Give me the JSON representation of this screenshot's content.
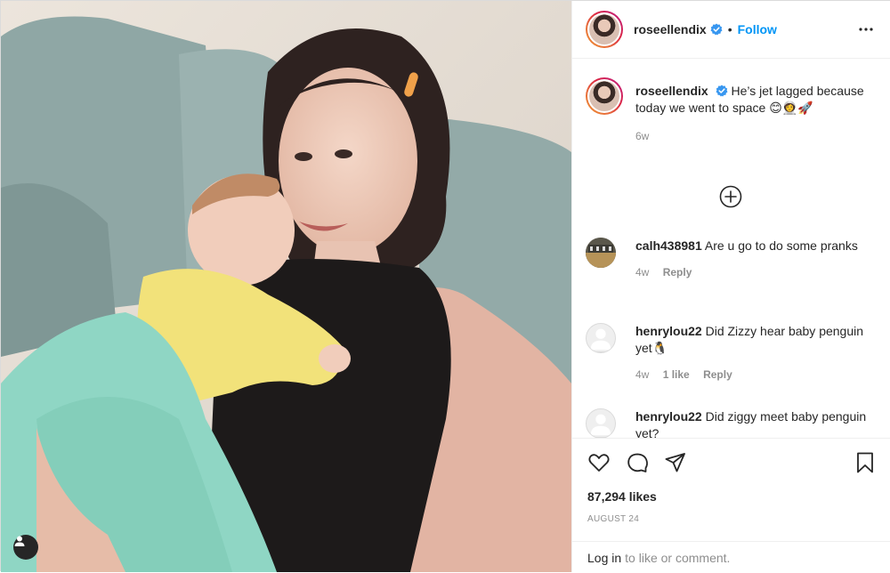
{
  "post": {
    "username": "roseellendix",
    "follow_label": "Follow",
    "dot": "•"
  },
  "caption": {
    "username": "roseellendix",
    "text": "He’s jet lagged because today we went to space 😊👩‍🚀🚀",
    "age": "6w"
  },
  "comments": [
    {
      "username": "calh438981",
      "text": "Are u go to do some pranks",
      "age": "4w",
      "likes": "",
      "reply_label": "Reply"
    },
    {
      "username": "henrylou22",
      "text": "Did Zizzy hear baby penguin yet🐧",
      "age": "4w",
      "likes": "1 like",
      "reply_label": "Reply"
    },
    {
      "username": "henrylou22",
      "text": "Did ziggy meet baby penguin yet?",
      "age": "",
      "likes": "",
      "reply_label": ""
    }
  ],
  "stats": {
    "likes": "87,294 likes",
    "date": "AUGUST 24"
  },
  "login_prompt": {
    "link": "Log in",
    "rest": "to like or comment."
  },
  "icons": {
    "verified": "verified-badge-icon",
    "more": "more-options-icon",
    "load_more": "plus-circle-icon",
    "like": "heart-icon",
    "comment": "comment-bubble-icon",
    "share": "paper-plane-icon",
    "save": "bookmark-icon",
    "tag": "user-tag-icon"
  },
  "colors": {
    "accent": "#0095f6",
    "muted": "#8e8e8e",
    "text": "#262626"
  }
}
